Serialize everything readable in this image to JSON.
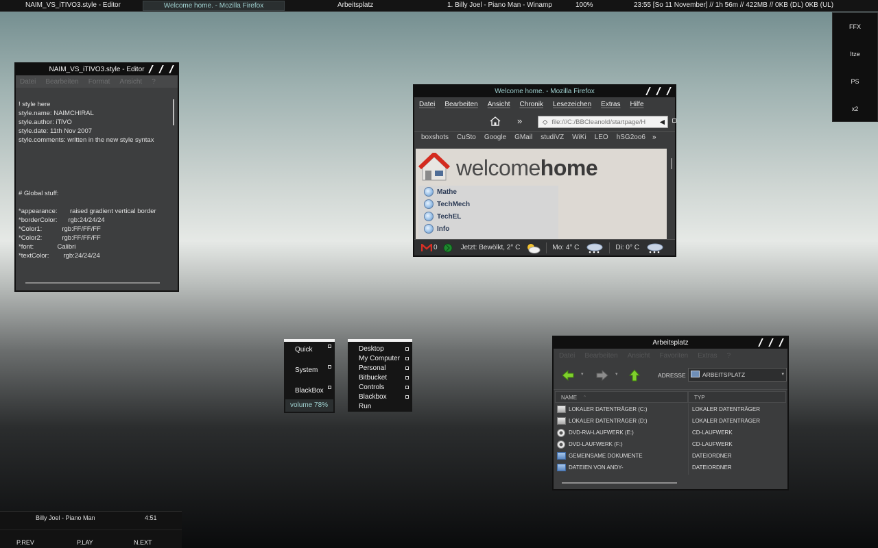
{
  "toolbar": {
    "items": [
      "NAIM_VS_iTIVO3.style - Editor",
      "Welcome home. - Mozilla Firefox",
      "Arbeitsplatz",
      "1. Billy Joel - Piano Man - Winamp",
      "100%",
      "23:55  [So 11 November] // 1h 56m // 422MB // 0KB (DL)  0KB (UL)"
    ]
  },
  "slit": {
    "items": [
      "FFX",
      "Itze",
      "PS",
      "x2"
    ]
  },
  "editor": {
    "title": "NAIM_VS_iTIVO3.style - Editor",
    "menu": [
      "Datei",
      "Bearbeiten",
      "Format",
      "Ansicht",
      "?"
    ],
    "text": "\n! style here\nstyle.name: NAIMCHIRAL\nstyle.author: iTiVO\nstyle.date: 11th Nov 2007\nstyle.comments: written in the new style syntax\n\n\n\n\n\n# Global stuff:\n\n*appearance:       raised gradient vertical border\n*borderColor:      rgb:24/24/24\n*Color1:           rgb:FF/FF/FF\n*Color2:           rgb:FF/FF/FF\n*font:             Calibri\n*textColor:        rgb:24/24/24"
  },
  "firefox": {
    "title": "Welcome home. - Mozilla Firefox",
    "menu": [
      "Datei",
      "Bearbeiten",
      "Ansicht",
      "Chronik",
      "Lesezeichen",
      "Extras",
      "Hilfe"
    ],
    "url": "file:///C:/BBCleanold/startpage/H",
    "bookmarks": [
      "boxshots",
      "CuSto",
      "Google",
      "GMail",
      "studiVZ",
      "WiKi",
      "LEO",
      "hSG2oo6"
    ],
    "brand_light": "welcome",
    "brand_bold": "home",
    "links": [
      "Mathe",
      "TechMech",
      "TechEL",
      "Info"
    ],
    "status": {
      "mail_count": "0",
      "now": "Jetzt: Bewölkt, 2° C",
      "mo": "Mo: 4° C",
      "di": "Di: 0° C"
    }
  },
  "menus": {
    "left": [
      "Quick",
      "System",
      "BlackBox"
    ],
    "volume": "volume 78%",
    "right": [
      "Desktop",
      "My Computer",
      "Personal",
      "Bitbucket",
      "Controls",
      "Blackbox",
      "Run"
    ]
  },
  "explorer": {
    "title": "Arbeitsplatz",
    "menu": [
      "Datei",
      "Bearbeiten",
      "Ansicht",
      "Favoriten",
      "Extras",
      "?"
    ],
    "address_label": "ADRESSE",
    "address_value": "ARBEITSPLATZ",
    "col_name": "NAME",
    "col_type": "TYP",
    "rows": [
      {
        "name": "LOKALER DATENTRÄGER (C:)",
        "type": "LOKALER DATENTRÄGER",
        "icon": "drive-icon"
      },
      {
        "name": "LOKALER DATENTRÄGER (D:)",
        "type": "LOKALER DATENTRÄGER",
        "icon": "drive-icon"
      },
      {
        "name": "DVD-RW-LAUFWERK (E:)",
        "type": "CD-LAUFWERK",
        "icon": "cd-icon"
      },
      {
        "name": "DVD-LAUFWERK (F:)",
        "type": "CD-LAUFWERK",
        "icon": "cd-icon"
      },
      {
        "name": "GEMEINSAME DOKUMENTE",
        "type": "DATEIORDNER",
        "icon": "folder-icon"
      },
      {
        "name": "DATEIEN VON ANDY-",
        "type": "DATEIORDNER",
        "icon": "folder-icon"
      }
    ]
  },
  "winamp": {
    "track": "Billy Joel - Piano Man",
    "time": "4:51",
    "prev": "P.REV",
    "play": "P.LAY",
    "next": "N.EXT"
  }
}
